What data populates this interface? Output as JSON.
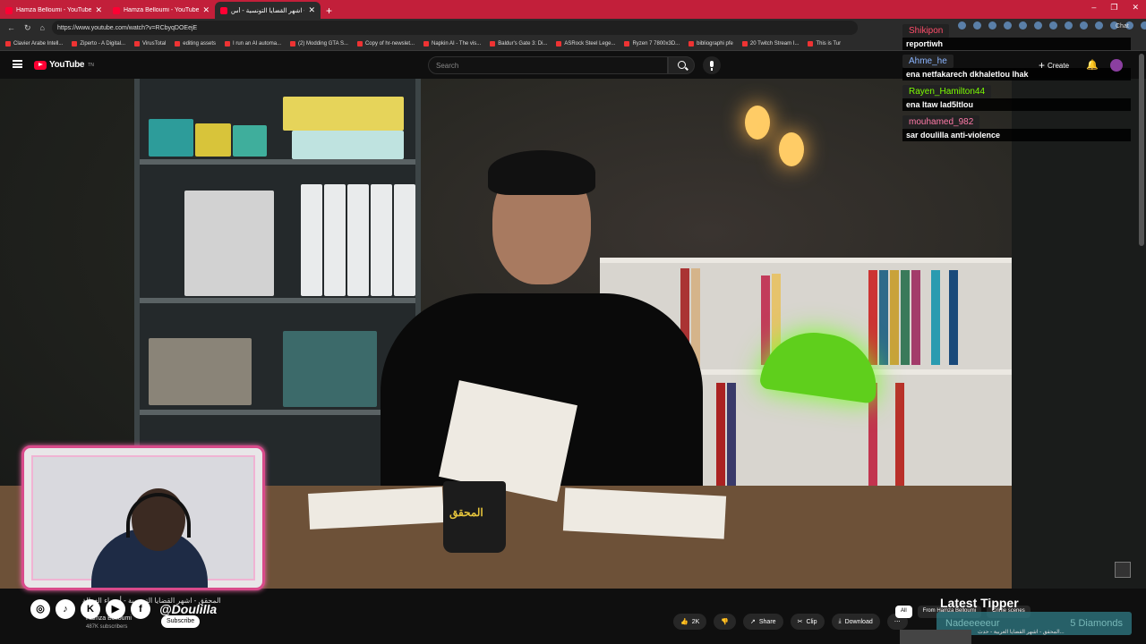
{
  "browser": {
    "tabs": [
      {
        "title": "Hamza Belloumi - YouTube"
      },
      {
        "title": "Hamza Belloumi - YouTube"
      },
      {
        "title": "المحقق - اشهر القضايا التونسية - أس"
      }
    ],
    "url": "https://www.youtube.com/watch?v=RCbyqDOEejE",
    "chat_label": "Chat",
    "bookmarks": [
      "Clavier Arabe Intell...",
      "Ziperto - A Digital...",
      "VirusTotal",
      "editing assets",
      "I run an AI automa...",
      "(2) Modding GTA S...",
      "Copy of hr-newslet...",
      "Napkin AI - The vis...",
      "Baldur's Gate 3: Di...",
      "ASRock Steel Lege...",
      "Ryzen 7 7800x3D...",
      "bibliographi pfe",
      "20 Twitch Stream I...",
      "This is Tur"
    ]
  },
  "youtube": {
    "logo_text": "YouTube",
    "logo_sup": "TN",
    "search_placeholder": "Search",
    "create_label": "Create"
  },
  "chat": [
    {
      "user": "Shikipon",
      "user_color": "#ff4d6a",
      "text": "reportiwh"
    },
    {
      "user": "Ahme_he",
      "user_color": "#8ab4ff",
      "text": "ena netfakarech dkhaletlou lhak"
    },
    {
      "user": "Rayen_Hamilton44",
      "user_color": "#7CFC00",
      "text": "ena ltaw lad5ltlou"
    },
    {
      "user": "mouhamed_982",
      "user_color": "#ff7aa8",
      "text": "sar doulilla anti-violence"
    }
  ],
  "video": {
    "desk_logo": "المحقق"
  },
  "overlay": {
    "handle": "@Doulilla",
    "latest_tipper_label": "Latest Tipper",
    "tipper_name": "Nadeeeeeur",
    "tipper_amount": "5 Diamonds"
  },
  "below_video": {
    "title": "المحقق - اشهر القضايا التونسية - أسماء الغزالة",
    "channel": "Hamza Belloumi",
    "subscribers": "487K subscribers",
    "subscribe_label": "Subscribe",
    "likes": "2K",
    "share_label": "Share",
    "clip_label": "Clip",
    "download_label": "Download",
    "chips": [
      "All",
      "From Hamza Belloumi",
      "Crime scenes"
    ],
    "rec_title": "المحقق - اشهر القضايا العربية - حدث..."
  }
}
